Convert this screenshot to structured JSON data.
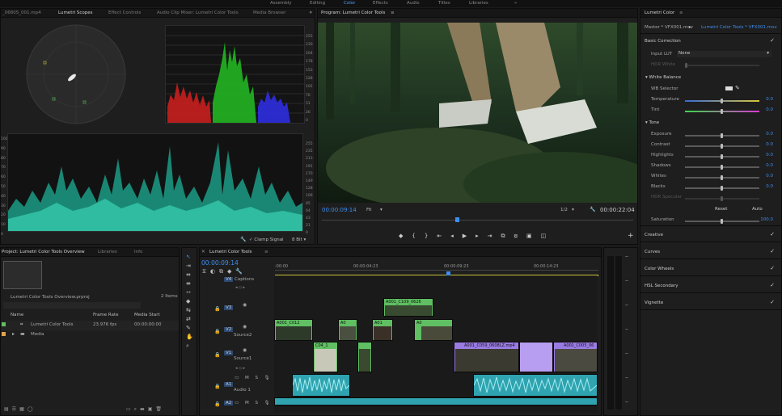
{
  "workspaces": [
    "Assembly",
    "Editing",
    "Color",
    "Effects",
    "Audio",
    "Titles",
    "Libraries"
  ],
  "active_workspace": "Color",
  "top_menu_glyph": "»",
  "source_panel": {
    "tabs": [
      "_06805_001.mp4",
      "Lumetri Scopes",
      "Effect Controls",
      "Audio Clip Mixer: Lumetri Color Tools",
      "Media Browser"
    ],
    "active_tab": "Lumetri Scopes",
    "scale_left": [
      "100",
      "90",
      "80",
      "70",
      "60",
      "50",
      "40",
      "30",
      "20",
      "10",
      "0"
    ],
    "scale_right_top": [
      "255",
      "230",
      "204",
      "178",
      "153",
      "128",
      "102",
      "76",
      "51",
      "26",
      "0"
    ],
    "scale_right_bottom": [
      "255",
      "235",
      "213",
      "191",
      "170",
      "149",
      "128",
      "106",
      "85",
      "64",
      "43",
      "21",
      "0"
    ],
    "clamp_label": "Clamp Signal",
    "bit_depth": "8 Bit"
  },
  "program": {
    "title": "Program: Lumetri Color Tools",
    "timecode_current": "00:00:09:14",
    "fit": "Fit",
    "quality": "1/2",
    "timecode_end": "00:00:22:04"
  },
  "lumetri": {
    "title": "Lumetri Color",
    "master": "Master * VFX001.mov",
    "sequence": "Lumetri Color Tools * VFX001.mov",
    "basic_correction": "Basic Correction",
    "input_lut_label": "Input LUT",
    "input_lut_value": "None",
    "hdr_white": "HDR White",
    "white_balance": "White Balance",
    "wb_selector": "WB Selector",
    "temperature": "Temperature",
    "temperature_val": "0.0",
    "tint": "Tint",
    "tint_val": "0.0",
    "tone": "Tone",
    "exposure": "Exposure",
    "exposure_val": "0.0",
    "contrast": "Contrast",
    "contrast_val": "0.0",
    "highlights": "Highlights",
    "highlights_val": "0.0",
    "shadows": "Shadows",
    "shadows_val": "0.0",
    "whites": "Whites",
    "whites_val": "0.0",
    "blacks": "Blacks",
    "blacks_val": "0.0",
    "hdr_specular": "HDR Specular",
    "reset": "Reset",
    "auto": "Auto",
    "saturation": "Saturation",
    "saturation_val": "100.0",
    "sections": [
      "Creative",
      "Curves",
      "Color Wheels",
      "HSL Secondary",
      "Vignette"
    ]
  },
  "project": {
    "tabs": [
      "Project: Lumetri Color Tools Overview",
      "Libraries",
      "Info"
    ],
    "project_file": "Lumetri Color Tools Overview.prproj",
    "items_count": "2 Items",
    "col_name": "Name",
    "col_fps": "Frame Rate",
    "col_start": "Media Start",
    "rows": [
      {
        "name": "Lumetri Color Tools",
        "fps": "23.976 fps",
        "start": "00:00:00:00"
      },
      {
        "name": "Media",
        "fps": "",
        "start": ""
      }
    ]
  },
  "timeline": {
    "title": "Lumetri Color Tools",
    "timecode": "00:00:09:14",
    "ruler": [
      ":00:00",
      "00:00:04:23",
      "00:00:09:23",
      "00:00:14:23"
    ],
    "tracks": [
      {
        "id": "V4",
        "name": "Captions"
      },
      {
        "id": "V3",
        "name": ""
      },
      {
        "id": "V2",
        "name": "Source2"
      },
      {
        "id": "V1",
        "name": "Source1"
      },
      {
        "id": "A1",
        "name": "Audio 1"
      },
      {
        "id": "A2",
        "name": ""
      }
    ],
    "clips": {
      "v3a": "A001_C109_0626",
      "v2a": "A001_C012",
      "v2b": "A0",
      "v2c": "A01",
      "v2d": "A0",
      "v1a": "C04_1",
      "v1b": "A001_C059_0608LZ.mp4",
      "v1c": "A001_C005_06"
    }
  },
  "colors": {
    "accent": "#3d8ef0",
    "clip_green": "#5fbf62",
    "clip_purple": "#9a7be3",
    "audio": "#2fa3b0"
  }
}
